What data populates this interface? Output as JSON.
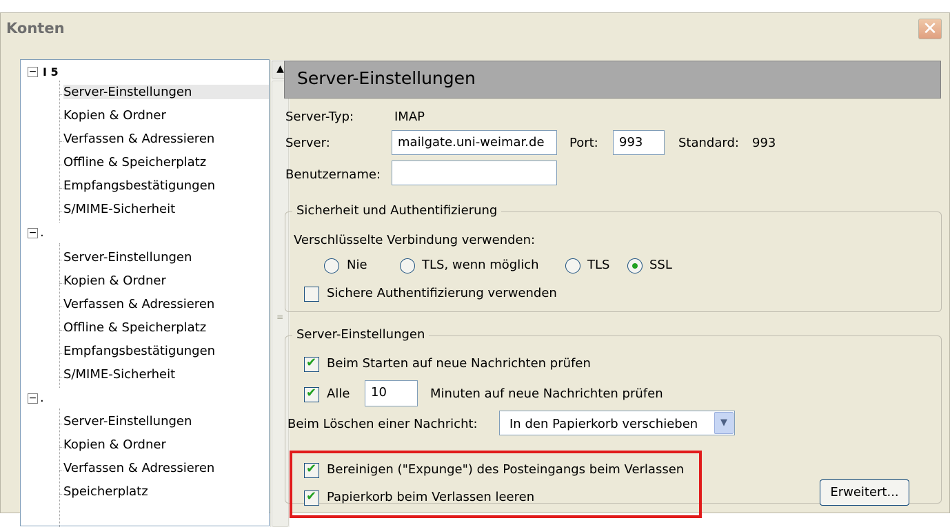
{
  "window": {
    "title": "Konten",
    "close_label": "✕"
  },
  "tree": {
    "accounts": [
      {
        "label": "I          5",
        "items": [
          "Server-Einstellungen",
          "Kopien & Ordner",
          "Verfassen & Adressieren",
          "Offline & Speicherplatz",
          "Empfangsbestätigungen",
          "S/MIME-Sicherheit"
        ]
      },
      {
        "label": ".",
        "items": [
          "Server-Einstellungen",
          "Kopien & Ordner",
          "Verfassen & Adressieren",
          "Offline & Speicherplatz",
          "Empfangsbestätigungen",
          "S/MIME-Sicherheit"
        ]
      },
      {
        "label": ".",
        "items": [
          "Server-Einstellungen",
          "Kopien & Ordner",
          "Verfassen & Adressieren",
          "Speicherplatz"
        ]
      }
    ],
    "toggle_glyph": "−",
    "selected_item": "Server-Einstellungen"
  },
  "panel": {
    "title": "Server-Einstellungen",
    "server_type_label": "Server-Typ:",
    "server_type_value": "IMAP",
    "server_label": "Server:",
    "server_value": "mailgate.uni-weimar.de",
    "port_label": "Port:",
    "port_value": "993",
    "standard_label": "Standard:",
    "standard_value": "993",
    "username_label": "Benutzername:",
    "username_value": ""
  },
  "security": {
    "group_title": "Sicherheit und Authentifizierung",
    "encryption_label": "Verschlüsselte Verbindung verwenden:",
    "options": [
      "Nie",
      "TLS, wenn möglich",
      "TLS",
      "SSL"
    ],
    "selected_option": "SSL",
    "secure_auth_label": "Sichere Authentifizierung verwenden",
    "secure_auth_checked": false
  },
  "server_settings": {
    "group_title": "Server-Einstellungen",
    "check_on_start_label": "Beim Starten auf neue Nachrichten prüfen",
    "check_on_start": true,
    "check_every_label": "Alle",
    "check_every_value": "10",
    "check_every_suffix": "Minuten auf neue Nachrichten prüfen",
    "check_every": true,
    "delete_label": "Beim Löschen einer Nachricht:",
    "delete_value": "In den Papierkorb verschieben",
    "expunge_label": "Bereinigen (\"Expunge\") des Posteingangs beim Verlassen",
    "expunge": true,
    "empty_trash_label": "Papierkorb beim Verlassen leeren",
    "empty_trash": true,
    "advanced_button": "Erweitert..."
  },
  "colors": {
    "highlight": "#e11b1b",
    "check_green": "#21a121",
    "header_gray": "#a9a9a9"
  }
}
